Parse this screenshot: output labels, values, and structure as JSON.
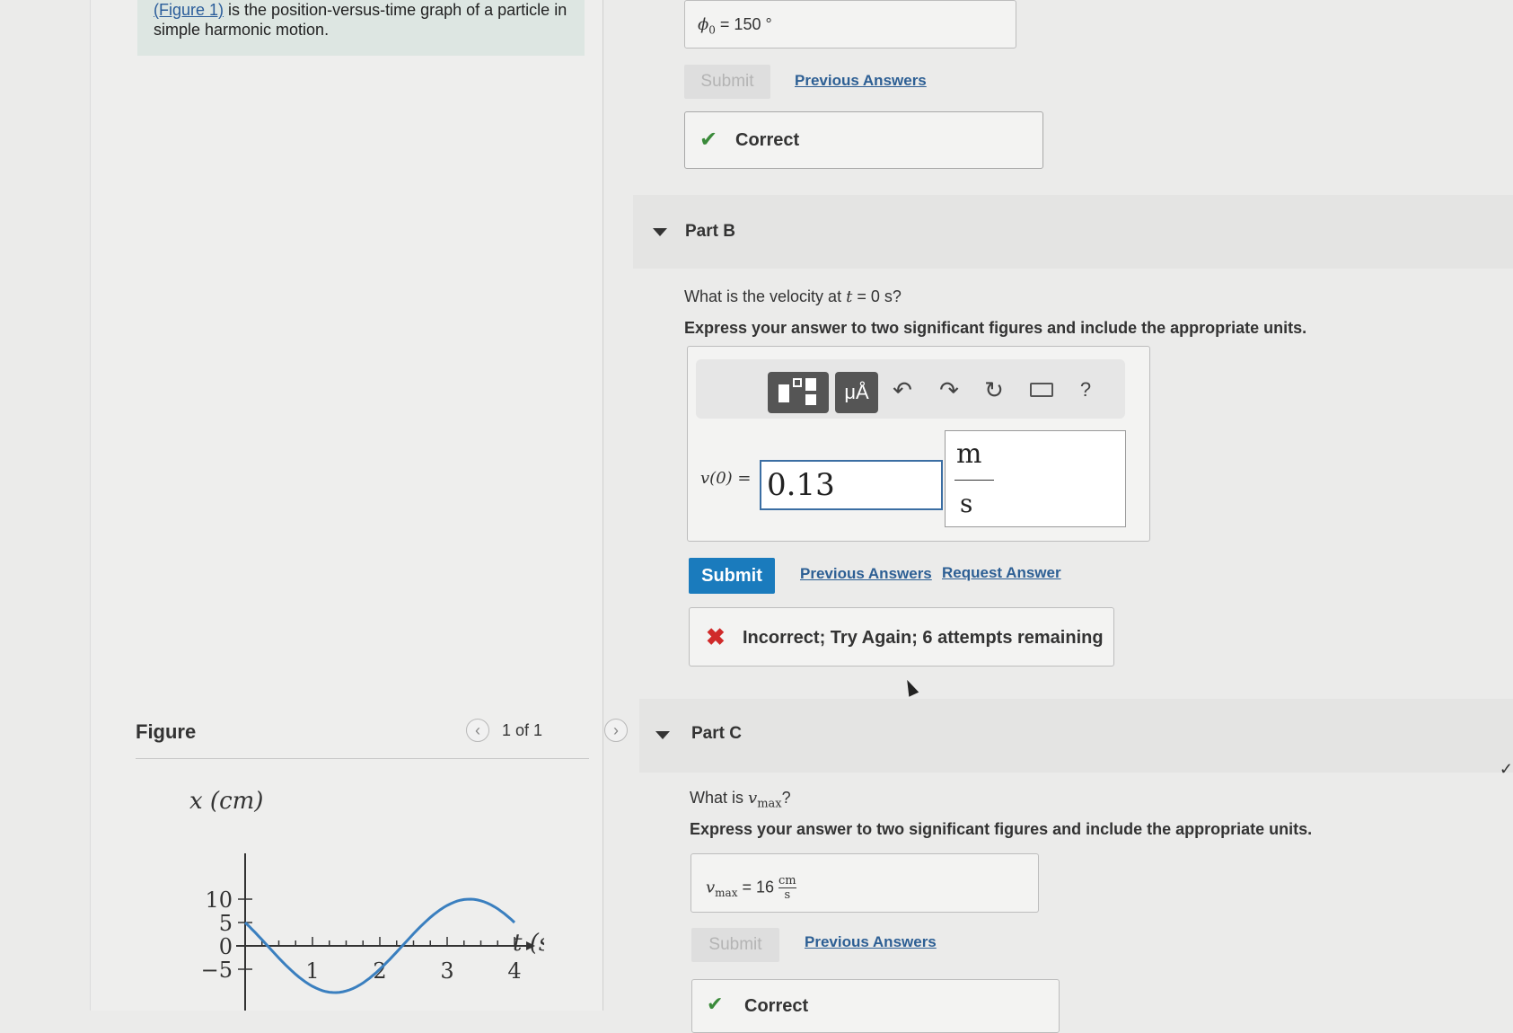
{
  "problem": {
    "figure_link": "(Figure 1)",
    "text": " is the position-versus-time graph of a particle in simple harmonic motion."
  },
  "figure": {
    "title": "Figure",
    "pager": "1 of 1",
    "prev_icon": "chevron-left-icon",
    "next_icon": "chevron-right-icon",
    "y_axis_label": "x (cm)",
    "x_axis_label": "t (s)"
  },
  "chart_data": {
    "type": "line",
    "xlabel": "t (s)",
    "ylabel": "x (cm)",
    "x_ticks": [
      "1",
      "2",
      "3",
      "4"
    ],
    "y_ticks": [
      "10",
      "5",
      "0",
      "−5"
    ],
    "xlim": [
      0,
      4.5
    ],
    "ylim": [
      -6,
      12
    ],
    "series": [
      {
        "x": [
          0,
          0.5,
          1.0,
          1.5,
          2.0,
          2.5,
          3.0,
          3.5,
          4.0
        ],
        "y": [
          5,
          -1.0,
          -7.0,
          -8.5,
          -5.0,
          1.0,
          7.0,
          10.0,
          5.0
        ]
      }
    ],
    "color": "#3a7fbf"
  },
  "part_a": {
    "answer_symbol": "ϕ",
    "answer_sub": "0",
    "answer_rest": " =  150  °",
    "submit_label": "Submit",
    "previous_answers": "Previous Answers",
    "feedback": "Correct"
  },
  "part_b": {
    "title": "Part B",
    "question_prefix": "What is the velocity at ",
    "question_var": "t",
    "question_suffix": " = 0 s?",
    "instructions": "Express your answer to two significant figures and include the appropriate units.",
    "toolbar": {
      "template_icon": "template-icon",
      "units_label": "μÅ",
      "undo_icon": "undo-icon",
      "redo_icon": "redo-icon",
      "reset_icon": "reset-icon",
      "keyboard_icon": "keyboard-icon",
      "help_label": "?"
    },
    "input_label": "v(0) =",
    "input_value": "0.13",
    "unit_numerator": "m",
    "unit_denominator": "s",
    "submit_label": "Submit",
    "previous_answers": "Previous Answers",
    "request_answer": "Request Answer",
    "feedback": "Incorrect; Try Again; 6 attempts remaining"
  },
  "part_c": {
    "title": "Part C",
    "question_prefix": "What is ",
    "question_var": "v",
    "question_sub": "max",
    "question_suffix": "?",
    "instructions": "Express your answer to two significant figures and include the appropriate units.",
    "answer_var": "v",
    "answer_sub": "max",
    "answer_eq": " =  16 ",
    "unit_numerator": "cm",
    "unit_denominator": "s",
    "submit_label": "Submit",
    "previous_answers": "Previous Answers",
    "feedback": "Correct"
  }
}
